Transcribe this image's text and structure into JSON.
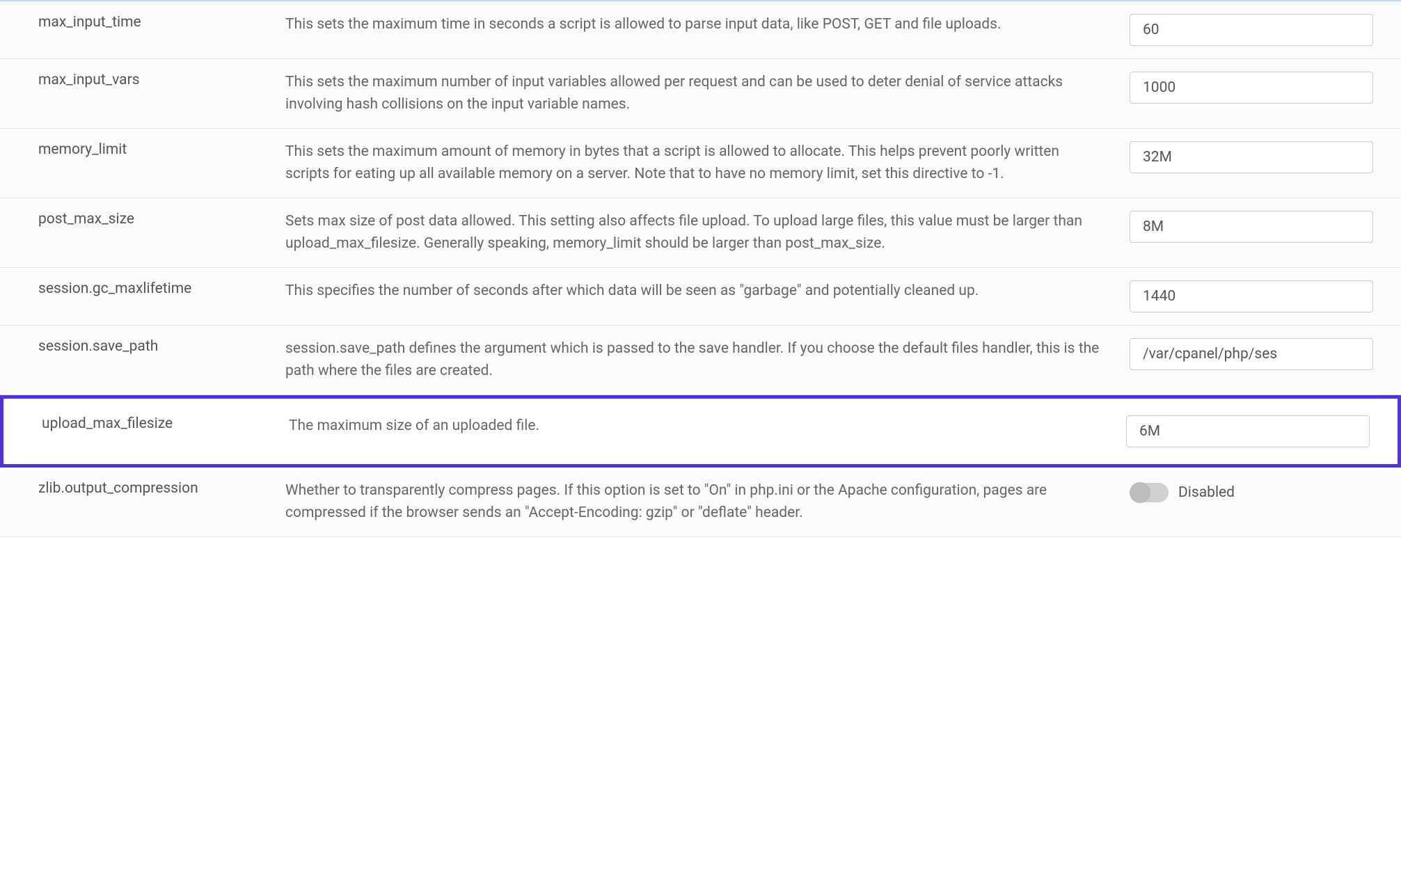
{
  "settings": [
    {
      "name": "max_input_time",
      "desc": "This sets the maximum time in seconds a script is allowed to parse input data, like POST, GET and file uploads.",
      "value": "60",
      "type": "text",
      "highlighted": false
    },
    {
      "name": "max_input_vars",
      "desc": "This sets the maximum number of input variables allowed per request and can be used to deter denial of service attacks involving hash collisions on the input variable names.",
      "value": "1000",
      "type": "text",
      "highlighted": false
    },
    {
      "name": "memory_limit",
      "desc": "This sets the maximum amount of memory in bytes that a script is allowed to allocate. This helps prevent poorly written scripts for eating up all available memory on a server. Note that to have no memory limit, set this directive to -1.",
      "value": "32M",
      "type": "text",
      "highlighted": false
    },
    {
      "name": "post_max_size",
      "desc": "Sets max size of post data allowed. This setting also affects file upload. To upload large files, this value must be larger than upload_max_filesize. Generally speaking, memory_limit should be larger than post_max_size.",
      "value": "8M",
      "type": "text",
      "highlighted": false
    },
    {
      "name": "session.gc_maxlifetime",
      "desc": "This specifies the number of seconds after which data will be seen as \"garbage\" and potentially cleaned up.",
      "value": "1440",
      "type": "text",
      "highlighted": false
    },
    {
      "name": "session.save_path",
      "desc": "session.save_path defines the argument which is passed to the save handler. If you choose the default files handler, this is the path where the files are created.",
      "value": "/var/cpanel/php/ses",
      "type": "text",
      "highlighted": false
    },
    {
      "name": "upload_max_filesize",
      "desc": "The maximum size of an uploaded file.",
      "value": "6M",
      "type": "text",
      "highlighted": true
    },
    {
      "name": "zlib.output_compression",
      "desc": "Whether to transparently compress pages. If this option is set to \"On\" in php.ini or the Apache configuration, pages are compressed if the browser sends an \"Accept-Encoding: gzip\" or \"deflate\" header.",
      "value": "Disabled",
      "type": "toggle",
      "highlighted": false
    }
  ]
}
